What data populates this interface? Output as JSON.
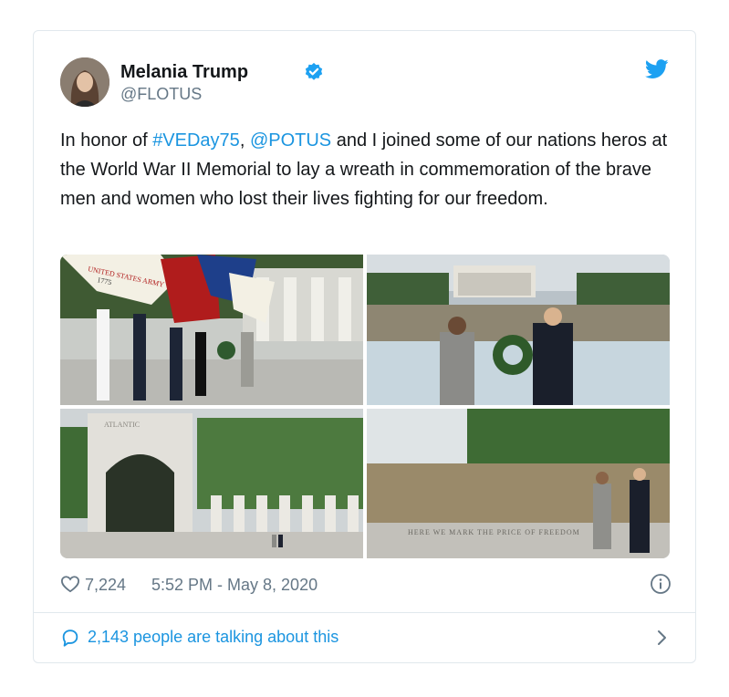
{
  "tweet": {
    "author_name": "Melania Trump",
    "handle": "@FLOTUS",
    "text_before_hashtag": "In honor of ",
    "hashtag": "#VEDay75",
    "text_between": ", ",
    "mention": "@POTUS",
    "text_after": " and I joined some of our nations heros at the World War II Memorial to lay a wreath in commemoration of the brave men and women who lost their lives fighting for our freedom.",
    "likes": "7,224",
    "timestamp": "5:52 PM - May 8, 2020",
    "talking": "2,143 people are talking about this"
  },
  "photo_text": {
    "army_flag": "UNITED STATES ARMY",
    "army_year": "1775",
    "arch_label": "ATLANTIC",
    "wall_inscription": "HERE WE MARK THE PRICE OF FREEDOM"
  },
  "icons": {
    "verified": "verified-badge-icon",
    "bird": "twitter-bird-icon",
    "heart": "heart-icon",
    "info": "info-icon",
    "comment": "comment-bubble-icon",
    "chevron": "chevron-right-icon"
  },
  "colors": {
    "link": "#1b95e0",
    "muted": "#657786",
    "border": "#e1e8ed"
  }
}
